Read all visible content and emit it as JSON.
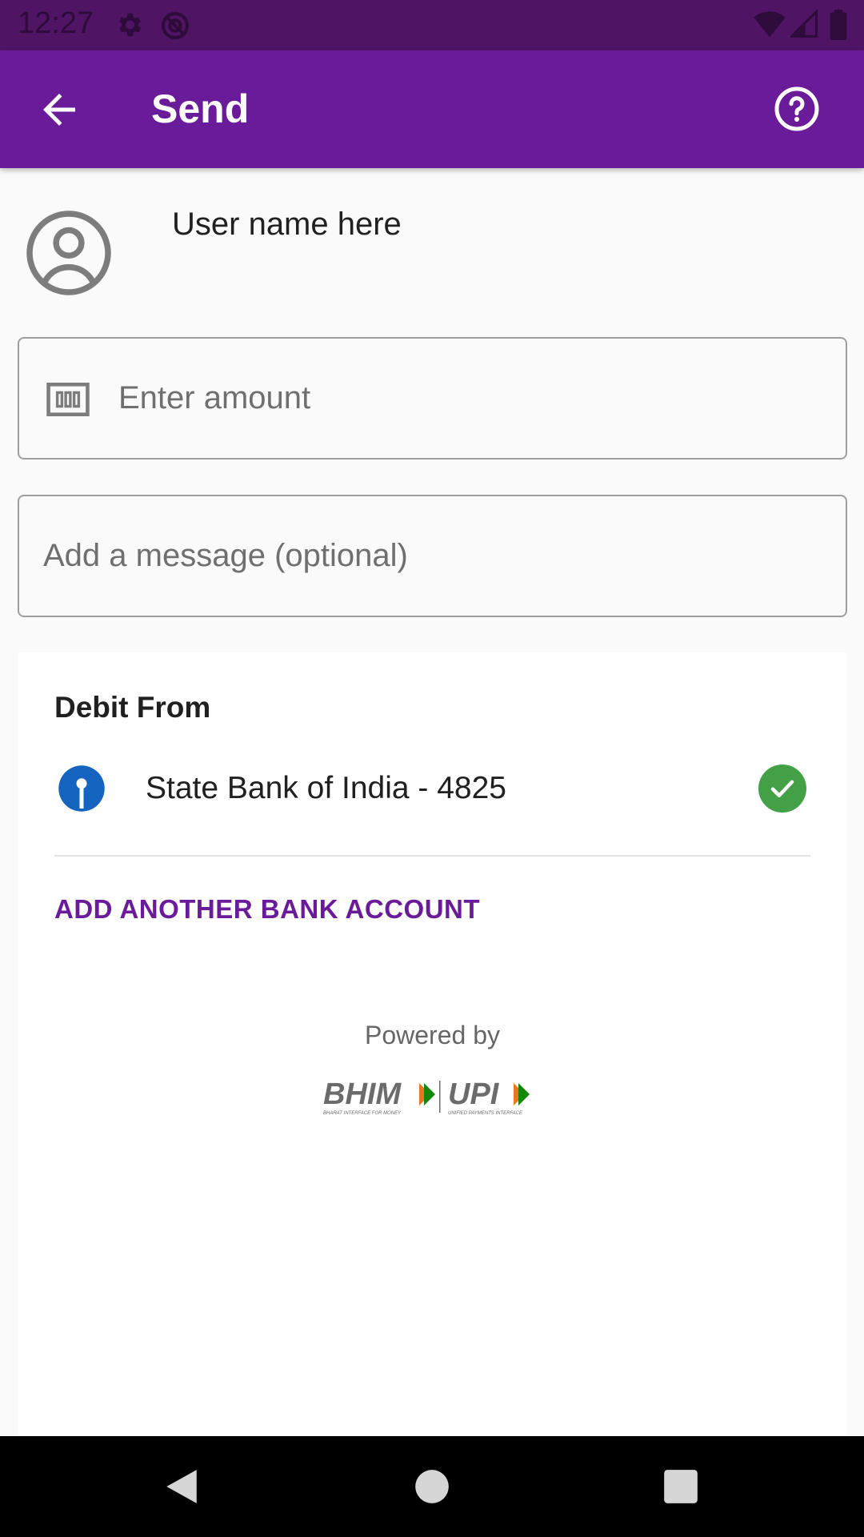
{
  "status_bar": {
    "time": "12:27",
    "icons": [
      "gear-icon",
      "sync-disabled-icon",
      "wifi-icon",
      "signal-icon",
      "battery-icon"
    ]
  },
  "app_bar": {
    "title": "Send",
    "back_icon": "arrow-left-icon",
    "help_icon": "help-circle-icon"
  },
  "recipient": {
    "name": "User name here",
    "avatar_icon": "account-circle-icon"
  },
  "amount": {
    "placeholder": "Enter amount",
    "icon": "money-icon"
  },
  "message": {
    "placeholder": "Add a message (optional)"
  },
  "debit": {
    "title": "Debit From",
    "bank_name": "State Bank of India - 4825",
    "selected": true,
    "add_label": "ADD ANOTHER BANK ACCOUNT"
  },
  "footer": {
    "powered_by": "Powered by",
    "logo_text_1": "BHIM",
    "logo_text_2": "UPI",
    "logo_sub_1": "BHARAT INTERFACE FOR MONEY",
    "logo_sub_2": "UNIFIED PAYMENTS INTERFACE"
  },
  "colors": {
    "primary": "#6a1b9a",
    "status_bar": "#4f1464",
    "check": "#43a047",
    "bank_blue": "#1565c0"
  }
}
